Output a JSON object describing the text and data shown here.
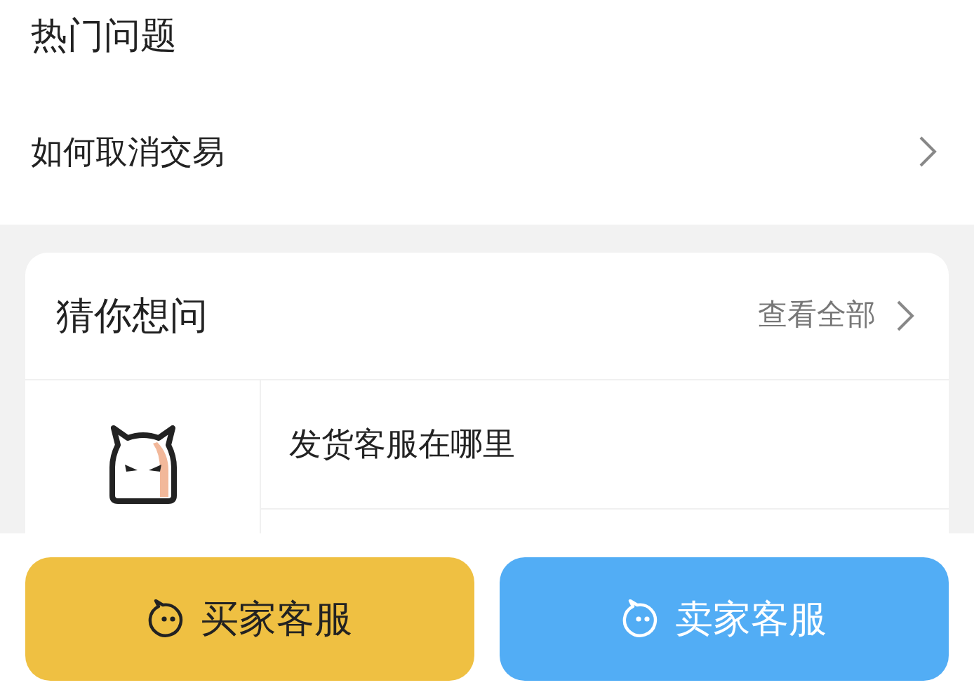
{
  "hot_questions": {
    "title": "热门问题",
    "items": [
      {
        "label": "如何取消交易"
      }
    ]
  },
  "guess_card": {
    "title": "猜你想问",
    "view_all": "查看全部",
    "questions": [
      {
        "label": "发货客服在哪里"
      }
    ]
  },
  "buttons": [
    {
      "label": "买家客服",
      "kind": "buyer"
    },
    {
      "label": "卖家客服",
      "kind": "seller"
    }
  ]
}
